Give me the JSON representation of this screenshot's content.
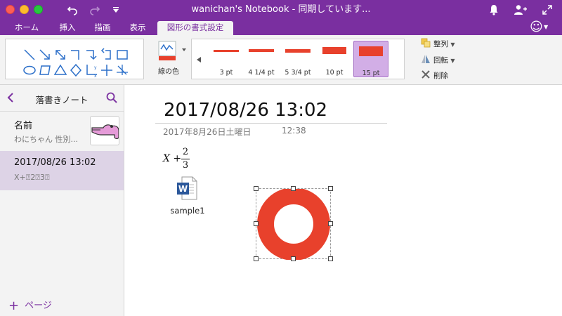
{
  "window": {
    "title": "wanichan's Notebook - 同期しています...",
    "undo_icon": "undo-icon",
    "redo_icon": "redo-icon",
    "qat_icon": "customize-toolbar-icon",
    "bell_icon": "bell-icon",
    "share_icon": "add-person-icon",
    "fullscreen_icon": "expand-icon"
  },
  "tabs": [
    {
      "label": "ホーム"
    },
    {
      "label": "挿入"
    },
    {
      "label": "描画"
    },
    {
      "label": "表示"
    },
    {
      "label": "図形の書式設定",
      "active": true
    }
  ],
  "ribbon": {
    "accent": "#7a2fa0",
    "shapes_label": "図形",
    "line_color": {
      "label": "線の色",
      "color": "#e8412c"
    },
    "weights": [
      {
        "label": "3 pt",
        "pt": 3
      },
      {
        "label": "4 1/4 pt",
        "pt": 4.25
      },
      {
        "label": "5 3/4 pt",
        "pt": 5.75
      },
      {
        "label": "10 pt",
        "pt": 10
      },
      {
        "label": "15 pt",
        "pt": 15,
        "selected": true
      }
    ],
    "arrange": {
      "label": "整列"
    },
    "rotate": {
      "label": "回転"
    },
    "delete": {
      "label": "削除"
    }
  },
  "sidebar": {
    "title": "落書きノート",
    "pages": [
      {
        "title": "名前",
        "subtitle": "わにちゃん 性別...",
        "has_thumbnail": true
      },
      {
        "title": "2017/08/26 13:02",
        "subtitle": "X+⍰2⍰3⍰",
        "selected": true
      }
    ],
    "add_page": "ページ"
  },
  "page": {
    "title": "2017/08/26 13:02",
    "date": "2017年8月26日土曜日",
    "time": "12:38",
    "equation": {
      "variable": "X",
      "operator": "+",
      "numerator": "2",
      "denominator": "3"
    },
    "attachment": {
      "name": "sample1",
      "icon": "word-document-icon"
    },
    "shape": {
      "type": "ring",
      "color": "#e8412c"
    }
  }
}
